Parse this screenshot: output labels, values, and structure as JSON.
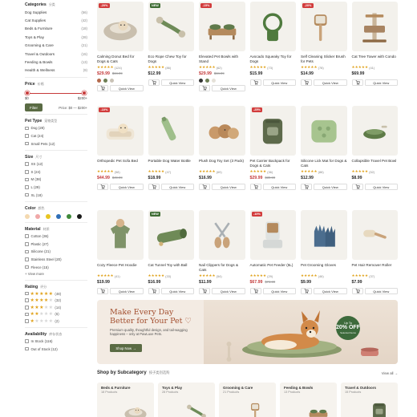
{
  "sidebar": {
    "categories": {
      "title": "Categories",
      "title_zh": "分类",
      "items": [
        {
          "label": "Dog Supplies",
          "count": "(56)"
        },
        {
          "label": "Cat Supplies",
          "count": "(42)"
        },
        {
          "label": "Beds & Furniture",
          "count": "(18)"
        },
        {
          "label": "Toys & Play",
          "count": "(28)"
        },
        {
          "label": "Grooming & Care",
          "count": "(21)"
        },
        {
          "label": "Travel & Outdoors",
          "count": "(15)"
        },
        {
          "label": "Feeding & Bowls",
          "count": "(13)"
        },
        {
          "label": "Health & Wellness",
          "count": "(9)"
        }
      ]
    },
    "price": {
      "title": "Price",
      "title_zh": "价格",
      "min": "$0",
      "max": "$200+",
      "filter_label": "Filter",
      "range_text": "Price: $0 — $200+"
    },
    "pet_type": {
      "title": "Pet Type",
      "title_zh": "宠物类型",
      "items": [
        "Dog (28)",
        "Cat (24)",
        "Small Pets (12)"
      ]
    },
    "size": {
      "title": "Size",
      "title_zh": "尺寸",
      "items": [
        "XS (12)",
        "S (24)",
        "M (38)",
        "L (29)",
        "XL (18)"
      ]
    },
    "color": {
      "title": "Color",
      "title_zh": "颜色",
      "swatches": [
        "#f4d9b0",
        "#f0a8a8",
        "#e8c521",
        "#2f6fb7",
        "#3f8a3a",
        "#1a1a1a"
      ]
    },
    "material": {
      "title": "Material",
      "title_zh": "材质",
      "items": [
        "Cotton (36)",
        "Plastic (27)",
        "Silicone (21)",
        "Stainless Steel (20)",
        "Fleece (15)"
      ],
      "view_more": "+ View more"
    },
    "rating": {
      "title": "Rating",
      "title_zh": "评分",
      "items": [
        {
          "stars": 5,
          "count": "(48)"
        },
        {
          "stars": 4,
          "count": "(32)"
        },
        {
          "stars": 3,
          "count": "(14)"
        },
        {
          "stars": 2,
          "count": "(6)"
        },
        {
          "stars": 1,
          "count": "(2)"
        }
      ]
    },
    "availability": {
      "title": "Availability",
      "title_zh": "库存状态",
      "items": [
        "In Stock (116)",
        "Out of Stock (12)"
      ]
    }
  },
  "quick_view_label": "Quick View",
  "products": [
    {
      "name": "Calming Donut Bed for Dogs & Cats",
      "badge": "-20%",
      "badge_type": "sale",
      "rating": "(124)",
      "price": "$29.99",
      "old": "$34.99",
      "swatches": [
        "#b46a4d",
        "#6e7f55",
        "#c9c2b6"
      ],
      "icon": "donut-bed"
    },
    {
      "name": "Eco Rope Chew Toy for Dogs",
      "badge": "NEW",
      "badge_type": "new",
      "rating": "(86)",
      "price": "$12.99",
      "old": "",
      "swatches": [],
      "icon": "rope-toy"
    },
    {
      "name": "Elevated Pet Bowls with Stand",
      "badge": "-15%",
      "badge_type": "sale",
      "rating": "(62)",
      "price": "$29.99",
      "old": "$34.99",
      "swatches": [
        "#333333",
        "#6e7f55",
        "#e5e1d8"
      ],
      "icon": "bowls"
    },
    {
      "name": "Avocado Squeaky Toy for Dogs",
      "badge": "",
      "badge_type": "",
      "rating": "(73)",
      "price": "$15.99",
      "old": "",
      "swatches": [],
      "icon": "leash"
    },
    {
      "name": "Self Cleaning Slicker Brush for Pets",
      "badge": "-20%",
      "badge_type": "sale",
      "rating": "(78)",
      "price": "$14.99",
      "old": "",
      "swatches": [],
      "icon": "brush"
    },
    {
      "name": "Cat Tree Tower with Condo",
      "badge": "",
      "badge_type": "",
      "rating": "(41)",
      "price": "$69.99",
      "old": "",
      "swatches": [],
      "icon": "cat-tree"
    },
    {
      "name": "Orthopedic Pet Sofa Bed",
      "badge": "-10%",
      "badge_type": "sale",
      "rating": "(58)",
      "price": "$44.99",
      "old": "$49.99",
      "swatches": [],
      "icon": "sofa-bed"
    },
    {
      "name": "Portable Dog Water Bottle",
      "badge": "",
      "badge_type": "",
      "rating": "(47)",
      "price": "$18.99",
      "old": "",
      "swatches": [],
      "icon": "bottle"
    },
    {
      "name": "Plush Dog Toy Set (3 Pack)",
      "badge": "",
      "badge_type": "",
      "rating": "(69)",
      "price": "$16.99",
      "old": "",
      "swatches": [],
      "icon": "plush"
    },
    {
      "name": "Pet Carrier Backpack for Dogs & Cats",
      "badge": "-25%",
      "badge_type": "sale",
      "rating": "(36)",
      "price": "$29.99",
      "old": "$39.99",
      "swatches": [],
      "icon": "backpack"
    },
    {
      "name": "Silicone Lick Mat for Dogs & Cats",
      "badge": "",
      "badge_type": "",
      "rating": "(88)",
      "price": "$12.99",
      "old": "",
      "swatches": [],
      "icon": "lick-mat"
    },
    {
      "name": "Collapsible Travel Pet Bowl",
      "badge": "",
      "badge_type": "",
      "rating": "(52)",
      "price": "$8.99",
      "old": "",
      "swatches": [],
      "icon": "travel-bowl"
    },
    {
      "name": "Cozy Fleece Pet Hoodie",
      "badge": "",
      "badge_type": "",
      "rating": "(41)",
      "price": "$19.99",
      "old": "",
      "swatches": [],
      "icon": "hoodie"
    },
    {
      "name": "Cat Tunnel Toy with Ball",
      "badge": "NEW",
      "badge_type": "new",
      "rating": "(33)",
      "price": "$16.99",
      "old": "",
      "swatches": [],
      "icon": "tunnel"
    },
    {
      "name": "Nail Clippers for Dogs & Cats",
      "badge": "",
      "badge_type": "",
      "rating": "(54)",
      "price": "$11.99",
      "old": "",
      "swatches": [],
      "icon": "clippers"
    },
    {
      "name": "Automatic Pet Feeder (5L)",
      "badge": "-10%",
      "badge_type": "sale",
      "rating": "(29)",
      "price": "$67.99",
      "old": "$74.99",
      "swatches": [],
      "icon": "feeder"
    },
    {
      "name": "Pet Grooming Gloves",
      "badge": "",
      "badge_type": "",
      "rating": "(46)",
      "price": "$9.99",
      "old": "",
      "swatches": [],
      "icon": "gloves"
    },
    {
      "name": "Pet Hair Remover Roller",
      "badge": "",
      "badge_type": "",
      "rating": "(37)",
      "price": "$7.99",
      "old": "",
      "swatches": [],
      "icon": "roller"
    }
  ],
  "banner": {
    "heading": "Make Every Day Better for Your Pet ♡",
    "text": "Premium quality, thoughtful design, and tail-wagging happiness – only at PawLuxe Pets.",
    "button": "Shop Now →",
    "promo_top": "Up To",
    "promo_big": "20% OFF",
    "promo_bottom": "Selected Items"
  },
  "subcategory": {
    "title": "Shop by Subcategory",
    "title_zh": "按子类别选购",
    "view_all": "View all →",
    "items": [
      {
        "name": "Beds & Furniture",
        "count": "18 Products",
        "icon": "donut-bed"
      },
      {
        "name": "Toys & Play",
        "count": "28 Products",
        "icon": "rope-toy"
      },
      {
        "name": "Grooming & Care",
        "count": "21 Products",
        "icon": "brush"
      },
      {
        "name": "Feeding & Bowls",
        "count": "13 Products",
        "icon": "bowls"
      },
      {
        "name": "Travel & Outdoors",
        "count": "15 Products",
        "icon": "backpack"
      }
    ]
  },
  "colors": {
    "accent": "#5a6b44",
    "sale": "#d23c3c",
    "new": "#3f6d34",
    "star": "#e0a21b"
  }
}
